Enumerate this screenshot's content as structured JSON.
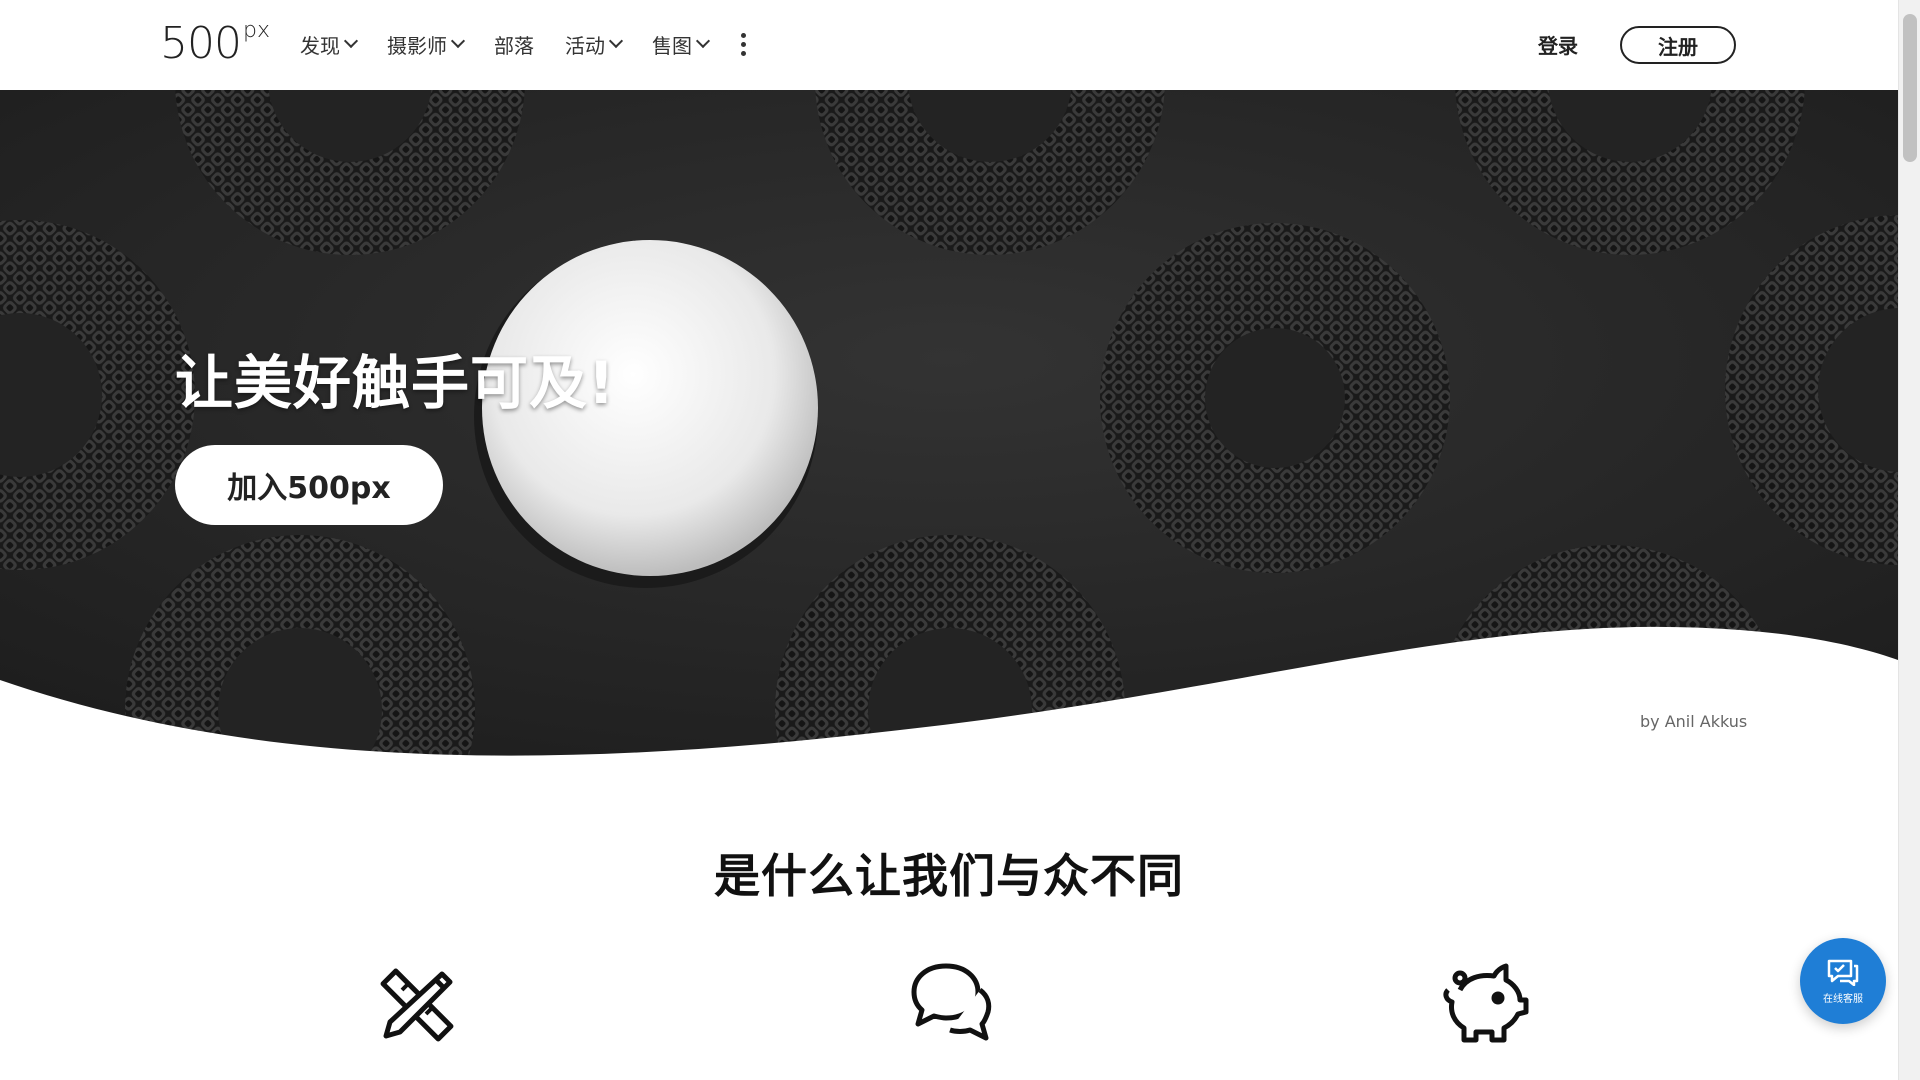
{
  "nav": {
    "logo_main": "500",
    "logo_sup": "px",
    "menu": [
      {
        "label": "发现",
        "dropdown": true
      },
      {
        "label": "摄影师",
        "dropdown": true
      },
      {
        "label": "部落",
        "dropdown": false
      },
      {
        "label": "活动",
        "dropdown": true
      },
      {
        "label": "售图",
        "dropdown": true
      }
    ],
    "login": "登录",
    "signup": "注册"
  },
  "hero": {
    "title": "让美好触手可及!",
    "cta": "加入500px",
    "credit": "by Anil Akkus"
  },
  "section": {
    "title": "是什么让我们与众不同",
    "icons": [
      "pencil-ruler-icon",
      "chat-bubbles-icon",
      "piggy-bank-icon"
    ]
  },
  "chat": {
    "label": "在线客服"
  },
  "colors": {
    "accent": "#1f7ed6",
    "text": "#111111",
    "hero_bg": "#2b2b2b"
  }
}
